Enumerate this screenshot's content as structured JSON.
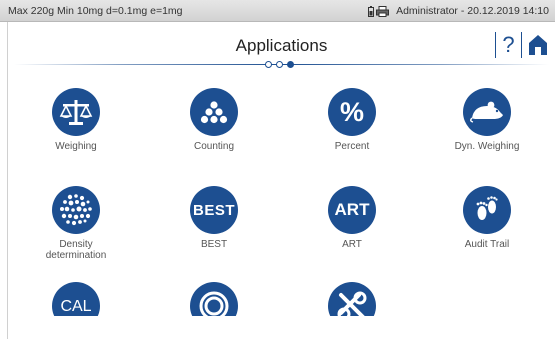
{
  "status": {
    "left": "Max 220g  Min 10mg  d=0.1mg  e=1mg",
    "right": "Administrator - 20.12.2019 14:10"
  },
  "header": {
    "title": "Applications",
    "help_label": "?"
  },
  "pager": {
    "pages": 3,
    "current": 3
  },
  "apps": [
    {
      "label": "Weighing",
      "icon": "balance-icon"
    },
    {
      "label": "Counting",
      "icon": "dots-icon"
    },
    {
      "label": "Percent",
      "icon": "percent-icon",
      "text": "%"
    },
    {
      "label": "Dyn. Weighing",
      "icon": "mouse-icon"
    },
    {
      "label": "Density determination",
      "icon": "bubbles-icon"
    },
    {
      "label": "BEST",
      "icon": "best-icon",
      "text": "BEST"
    },
    {
      "label": "ART",
      "icon": "art-icon",
      "text": "ART"
    },
    {
      "label": "Audit Trail",
      "icon": "footprints-icon"
    },
    {
      "label": "",
      "icon": "cal-icon",
      "text": "CAL"
    },
    {
      "label": "",
      "icon": "ring-icon"
    },
    {
      "label": "",
      "icon": "tools-icon"
    }
  ],
  "colors": {
    "accent": "#1d4f91",
    "statusbar": "#dcdcdc"
  }
}
